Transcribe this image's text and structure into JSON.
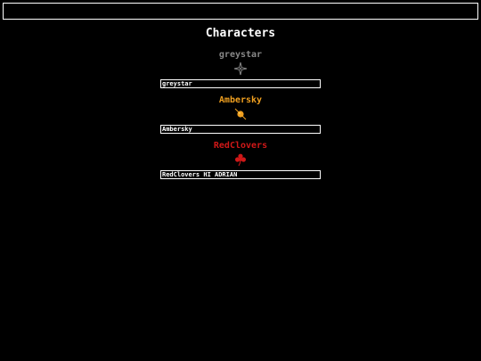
{
  "top_bar": {
    "value": ""
  },
  "page": {
    "title": "Characters"
  },
  "characters": [
    {
      "name": "greystar",
      "color": "#888888",
      "icon": "four-point-star-icon",
      "field_value": "greystar"
    },
    {
      "name": "Ambersky",
      "color": "#f0a020",
      "icon": "amber-orb-icon",
      "field_value": "Ambersky"
    },
    {
      "name": "RedClovers",
      "color": "#d01818",
      "icon": "clover-icon",
      "field_value": "RedClovers HI ADRIAN"
    }
  ]
}
